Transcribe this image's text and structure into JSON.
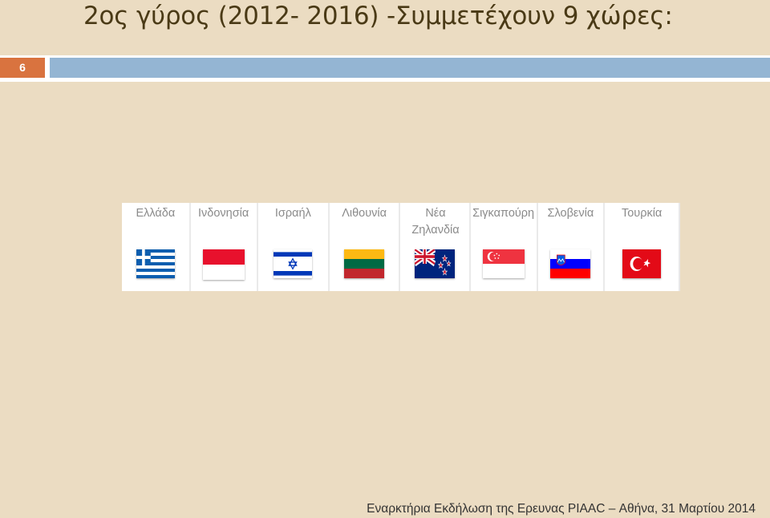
{
  "slide": {
    "title": "2ος γύρος (2012- 2016) -Συμμετέχουν 9 χώρες:",
    "number": "6",
    "footer": "Εναρκτήρια Εκδήλωση της Ερευνας PIAAC – Αθήνα, 31 Μαρτίου 2014"
  },
  "countries": [
    {
      "name": "Ελλάδα",
      "flag": "greece-flag-icon"
    },
    {
      "name": "Ινδονησία",
      "flag": "indonesia-flag-icon"
    },
    {
      "name": "Ισραήλ",
      "flag": "israel-flag-icon"
    },
    {
      "name": "Λιθουνία",
      "flag": "lithuania-flag-icon"
    },
    {
      "name": "Νέα Ζηλανδία",
      "flag": "new-zealand-flag-icon"
    },
    {
      "name": "Σιγκαπούρη",
      "flag": "singapore-flag-icon"
    },
    {
      "name": "Σλοβενία",
      "flag": "slovenia-flag-icon"
    },
    {
      "name": "Τουρκία",
      "flag": "turkey-flag-icon"
    }
  ],
  "colors": {
    "background": "#ebdcc2",
    "accent_orange": "#d9733f",
    "accent_blue": "#94b5d3",
    "title_text": "#4a3a16"
  }
}
